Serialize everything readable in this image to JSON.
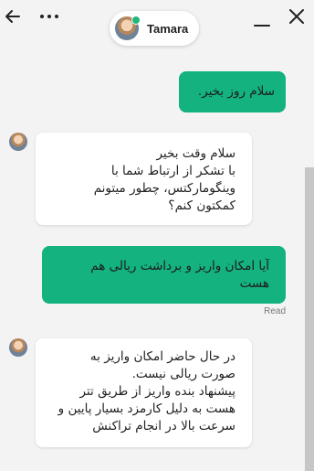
{
  "header": {
    "agent_name": "Tamara",
    "agent_status": "online",
    "icons": {
      "back": "arrow-left-icon",
      "more": "more-horizontal-icon",
      "minimize": "minimize-icon",
      "close": "close-icon"
    }
  },
  "colors": {
    "outgoing_bubble": "#14b27f",
    "incoming_bubble": "#ffffff",
    "online": "#1fb87a",
    "background": "#f3f3f3"
  },
  "messages": [
    {
      "direction": "outgoing",
      "text": "سلام روز بخیر."
    },
    {
      "direction": "incoming",
      "text": "سلام وقت بخیر\nبا تشکر از ارتباط شما با وینگومارکتس، چطور میتونم کمکتون کنم؟"
    },
    {
      "direction": "outgoing",
      "text": "آیا امکان واریز و برداشت ریالی هم هست"
    },
    {
      "direction": "incoming",
      "text": "در حال حاضر امکان واریز به صورت ریالی نیست.\nپیشنهاد بنده واریز از طریق تتر هست به دلیل کارمزد بسیار پایین و سرعت بالا در انجام تراکنش"
    }
  ],
  "read_receipt": "Read"
}
